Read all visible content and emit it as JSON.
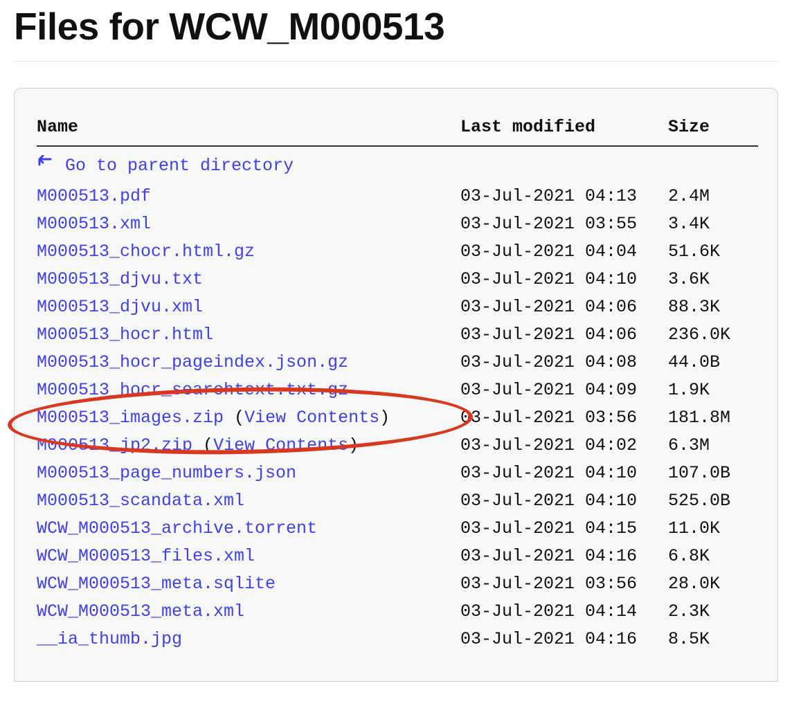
{
  "title": "Files for WCW_M000513",
  "columns": {
    "name": "Name",
    "modified": "Last modified",
    "size": "Size"
  },
  "parent_link": "Go to parent directory",
  "view_contents_label": "View Contents",
  "files": [
    {
      "name": "M000513.pdf",
      "modified": "03-Jul-2021 04:13",
      "size": "2.4M",
      "viewable": false,
      "highlighted": false
    },
    {
      "name": "M000513.xml",
      "modified": "03-Jul-2021 03:55",
      "size": "3.4K",
      "viewable": false,
      "highlighted": false
    },
    {
      "name": "M000513_chocr.html.gz",
      "modified": "03-Jul-2021 04:04",
      "size": "51.6K",
      "viewable": false,
      "highlighted": false
    },
    {
      "name": "M000513_djvu.txt",
      "modified": "03-Jul-2021 04:10",
      "size": "3.6K",
      "viewable": false,
      "highlighted": false
    },
    {
      "name": "M000513_djvu.xml",
      "modified": "03-Jul-2021 04:06",
      "size": "88.3K",
      "viewable": false,
      "highlighted": false
    },
    {
      "name": "M000513_hocr.html",
      "modified": "03-Jul-2021 04:06",
      "size": "236.0K",
      "viewable": false,
      "highlighted": false
    },
    {
      "name": "M000513_hocr_pageindex.json.gz",
      "modified": "03-Jul-2021 04:08",
      "size": "44.0B",
      "viewable": false,
      "highlighted": false
    },
    {
      "name": "M000513_hocr_searchtext.txt.gz",
      "modified": "03-Jul-2021 04:09",
      "size": "1.9K",
      "viewable": false,
      "highlighted": false
    },
    {
      "name": "M000513_images.zip",
      "modified": "03-Jul-2021 03:56",
      "size": "181.8M",
      "viewable": true,
      "highlighted": true
    },
    {
      "name": "M000513_jp2.zip",
      "modified": "03-Jul-2021 04:02",
      "size": "6.3M",
      "viewable": true,
      "highlighted": false
    },
    {
      "name": "M000513_page_numbers.json",
      "modified": "03-Jul-2021 04:10",
      "size": "107.0B",
      "viewable": false,
      "highlighted": false
    },
    {
      "name": "M000513_scandata.xml",
      "modified": "03-Jul-2021 04:10",
      "size": "525.0B",
      "viewable": false,
      "highlighted": false
    },
    {
      "name": "WCW_M000513_archive.torrent",
      "modified": "03-Jul-2021 04:15",
      "size": "11.0K",
      "viewable": false,
      "highlighted": false
    },
    {
      "name": "WCW_M000513_files.xml",
      "modified": "03-Jul-2021 04:16",
      "size": "6.8K",
      "viewable": false,
      "highlighted": false
    },
    {
      "name": "WCW_M000513_meta.sqlite",
      "modified": "03-Jul-2021 03:56",
      "size": "28.0K",
      "viewable": false,
      "highlighted": false
    },
    {
      "name": "WCW_M000513_meta.xml",
      "modified": "03-Jul-2021 04:14",
      "size": "2.3K",
      "viewable": false,
      "highlighted": false
    },
    {
      "name": "__ia_thumb.jpg",
      "modified": "03-Jul-2021 04:16",
      "size": "8.5K",
      "viewable": false,
      "highlighted": false
    }
  ],
  "annotation": {
    "color": "#d8381e",
    "target_file": "M000513_images.zip"
  }
}
